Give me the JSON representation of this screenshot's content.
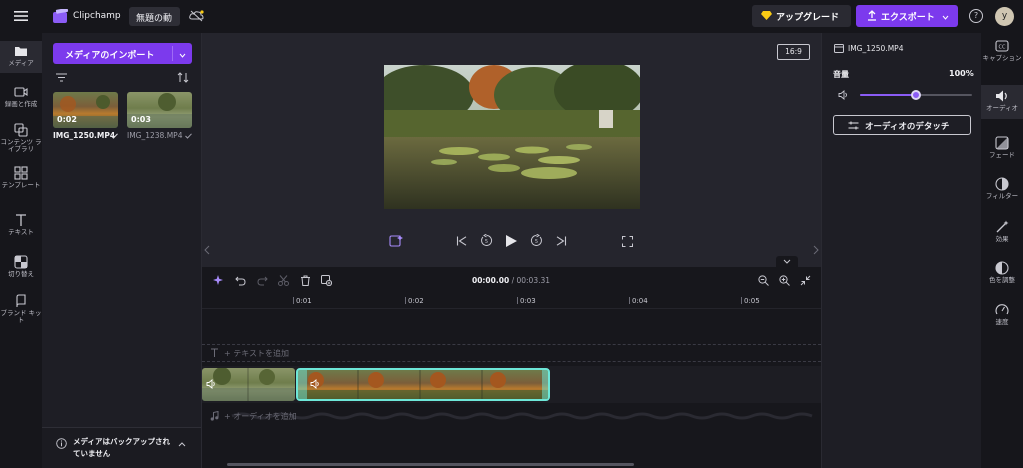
{
  "topbar": {
    "app_name": "Clipchamp",
    "project_tab": "無題の動",
    "upgrade_label": "アップグレード",
    "export_label": "エクスポート",
    "help_label": "?",
    "avatar_letter": "y"
  },
  "leftnav": {
    "items": [
      {
        "label": "メディア"
      },
      {
        "label": "録画と作成"
      },
      {
        "label": "コンテンツ ライブラリ"
      },
      {
        "label": "テンプレート"
      },
      {
        "label": "テキスト"
      },
      {
        "label": "切り替え"
      },
      {
        "label": "ブランド キット"
      }
    ]
  },
  "media": {
    "import_label": "メディアのインポート",
    "items": [
      {
        "name": "IMG_1250.MP4",
        "duration": "0:02",
        "selected": true
      },
      {
        "name": "IMG_1238.MP4",
        "duration": "0:03",
        "selected": false
      }
    ],
    "backup_notice": "メディアはバックアップされていません"
  },
  "preview": {
    "aspect_label": "16:9"
  },
  "timeline": {
    "current_time": "00:00.00",
    "separator": "/",
    "total_time": "00:03.31",
    "ruler": [
      "0:01",
      "0:02",
      "0:03",
      "0:04",
      "0:05"
    ],
    "text_track_label": "+ テキストを追加",
    "audio_track_label": "+ オーディオを追加"
  },
  "properties": {
    "file_name": "IMG_1250.MP4",
    "volume_label": "音量",
    "volume_value": "100%",
    "volume_fraction": 0.5,
    "detach_label": "オーディオのデタッチ"
  },
  "rightnav": {
    "items": [
      {
        "label": "キャプション"
      },
      {
        "label": "オーディオ"
      },
      {
        "label": "フェード"
      },
      {
        "label": "フィルター"
      },
      {
        "label": "効果"
      },
      {
        "label": "色を調整"
      },
      {
        "label": "速度"
      }
    ]
  },
  "colors": {
    "accent": "#7c3aed",
    "clip_border": "#6ee7d8",
    "background": "#1e1e25"
  }
}
